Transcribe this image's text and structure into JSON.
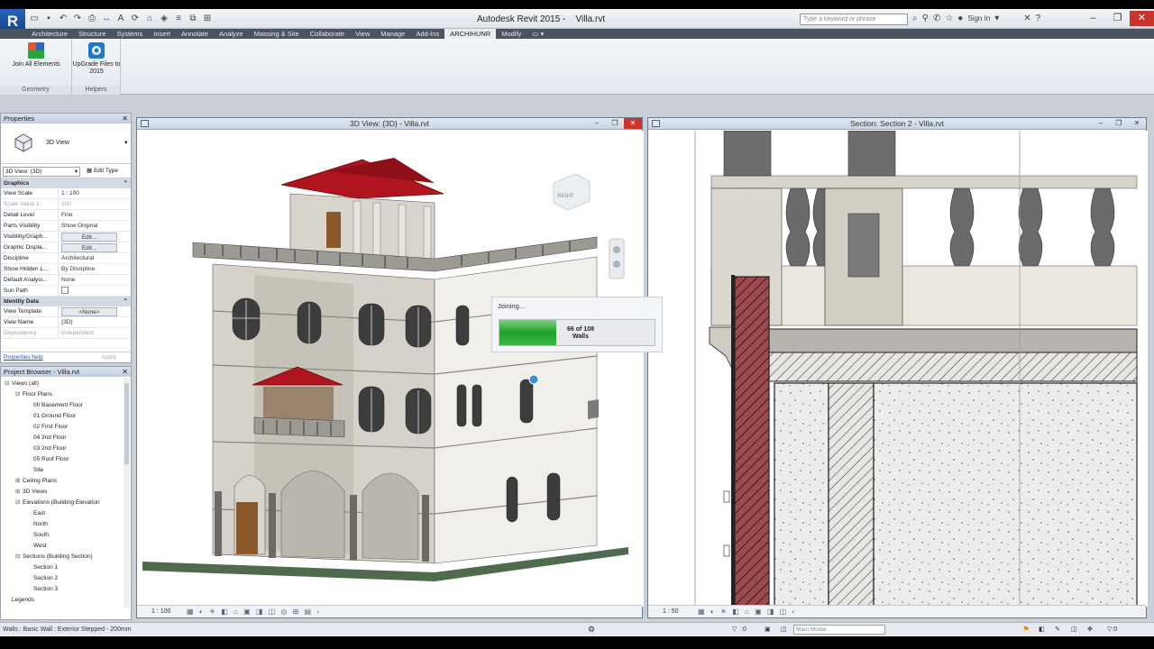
{
  "app": {
    "title": "Autodesk Revit 2015 -",
    "file": "Villa.rvt",
    "logo": "R",
    "search_placeholder": "Type a keyword or phrase",
    "signin": "Sign In"
  },
  "tabs": [
    "Architecture",
    "Structure",
    "Systems",
    "Insert",
    "Annotate",
    "Analyze",
    "Massing & Site",
    "Collaborate",
    "View",
    "Manage",
    "Add-Ins",
    "ARCHIHUNR",
    "Modify"
  ],
  "active_tab": "ARCHIHUNR",
  "ribbon": {
    "join_label": "Join All Elements",
    "upgrade_label": "UpGrade Files to 2015",
    "panel_geometry": "Geometry",
    "panel_helpers": "Helpers"
  },
  "properties": {
    "title": "Properties",
    "type_name": "3D View",
    "selector": "3D View: {3D}",
    "edit_type": "Edit Type",
    "sec_graphics": "Graphics",
    "sec_identity": "Identity Data",
    "rows": [
      {
        "k": "View Scale",
        "v": "1 : 100"
      },
      {
        "k": "Scale Value    1:",
        "v": "100"
      },
      {
        "k": "Detail Level",
        "v": "Fine"
      },
      {
        "k": "Parts Visibility",
        "v": "Show Original"
      },
      {
        "k": "Visibility/Graph...",
        "v": "Edit..."
      },
      {
        "k": "Graphic Displa...",
        "v": "Edit..."
      },
      {
        "k": "Discipline",
        "v": "Architectural"
      },
      {
        "k": "Show Hidden L...",
        "v": "By Discipline"
      },
      {
        "k": "Default Analysi...",
        "v": "None"
      },
      {
        "k": "Sun Path",
        "v": ""
      }
    ],
    "identity_rows": [
      {
        "k": "View Template",
        "v": "<None>"
      },
      {
        "k": "View Name",
        "v": "{3D}"
      },
      {
        "k": "Dependency",
        "v": "Independent"
      }
    ],
    "help": "Properties help",
    "apply": "Apply"
  },
  "browser": {
    "title": "Project Browser - Villa.rvt",
    "items": [
      {
        "t": "Views (all)",
        "lvl": 0,
        "tg": "⊟"
      },
      {
        "t": "Floor Plans",
        "lvl": 1,
        "tg": "⊟"
      },
      {
        "t": "00 Basement Floor",
        "lvl": 2,
        "tg": ""
      },
      {
        "t": "01 Ground Floor",
        "lvl": 2,
        "tg": ""
      },
      {
        "t": "02 First Floor",
        "lvl": 2,
        "tg": ""
      },
      {
        "t": "04 3nd Floor",
        "lvl": 2,
        "tg": ""
      },
      {
        "t": "03 2nd Floor",
        "lvl": 2,
        "tg": ""
      },
      {
        "t": "05 Roof Floor",
        "lvl": 2,
        "tg": ""
      },
      {
        "t": "Site",
        "lvl": 2,
        "tg": ""
      },
      {
        "t": "Ceiling Plans",
        "lvl": 1,
        "tg": "⊞"
      },
      {
        "t": "3D Views",
        "lvl": 1,
        "tg": "⊞"
      },
      {
        "t": "Elevations (Building Elevation",
        "lvl": 1,
        "tg": "⊟"
      },
      {
        "t": "East",
        "lvl": 2,
        "tg": ""
      },
      {
        "t": "North",
        "lvl": 2,
        "tg": ""
      },
      {
        "t": "South",
        "lvl": 2,
        "tg": ""
      },
      {
        "t": "West",
        "lvl": 2,
        "tg": ""
      },
      {
        "t": "Sections (Building Section)",
        "lvl": 1,
        "tg": "⊟"
      },
      {
        "t": "Section 1",
        "lvl": 2,
        "tg": ""
      },
      {
        "t": "Section 2",
        "lvl": 2,
        "tg": ""
      },
      {
        "t": "Section 3",
        "lvl": 2,
        "tg": ""
      },
      {
        "t": "Legends",
        "lvl": 0,
        "tg": ""
      }
    ]
  },
  "view3d": {
    "title": "3D View: {3D} - Villa.rvt",
    "scale": "1 : 100",
    "cube_label": "RIGHT"
  },
  "section": {
    "title": "Section: Section 2 - Villa.rvt",
    "scale": "1 : 50"
  },
  "progress": {
    "label": "Joining...",
    "current": 66,
    "total": 108,
    "unit": "Walls",
    "text": "66 of 108"
  },
  "status": {
    "text": "Walls : Basic Wall : Exterior Stepped - 200mm",
    "model": "Main Model",
    "zero": ":0"
  },
  "colors": {
    "accent": "#1f9e2a",
    "brand": "#1e54a8",
    "roof": "#a8121c"
  }
}
